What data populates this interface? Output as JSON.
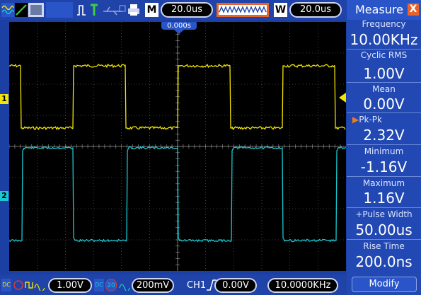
{
  "toolbar": {
    "m_label": "M",
    "timebase": "20.0us",
    "w_label": "W",
    "window_timebase": "20.0us"
  },
  "screen": {
    "trigger_time": "0.000s",
    "ch1_marker": "1",
    "ch2_marker": "2"
  },
  "measure": {
    "title": "Measure",
    "close_label": "X",
    "items": [
      {
        "label": "Frequency",
        "value": "10.00KHz"
      },
      {
        "label": "Cyclic RMS",
        "value": "1.00V"
      },
      {
        "label": "Mean",
        "value": "0.00V"
      },
      {
        "label": "Pk-Pk",
        "value": "2.32V"
      },
      {
        "label": "Minimum",
        "value": "-1.16V"
      },
      {
        "label": "Maximum",
        "value": "1.16V"
      },
      {
        "label": "+Pulse Width",
        "value": "50.00us"
      },
      {
        "label": "Rise Time",
        "value": "200.0ns"
      }
    ],
    "selected_marker": "▶",
    "modify_label": "Modify"
  },
  "bottom": {
    "ch1_coupling": "DC",
    "ch1_scale": "1.00V",
    "ch2_coupling": "DC",
    "ch2_bw": "20",
    "ch2_scale": "200mV",
    "trigger_source": "CH1",
    "trigger_level": "0.00V",
    "trigger_freq": "10.0000KHz"
  },
  "colors": {
    "ch1": "#f2e600",
    "ch2": "#19c8d2",
    "background": "#1b3fa3",
    "sidebar": "#2148b3"
  }
}
